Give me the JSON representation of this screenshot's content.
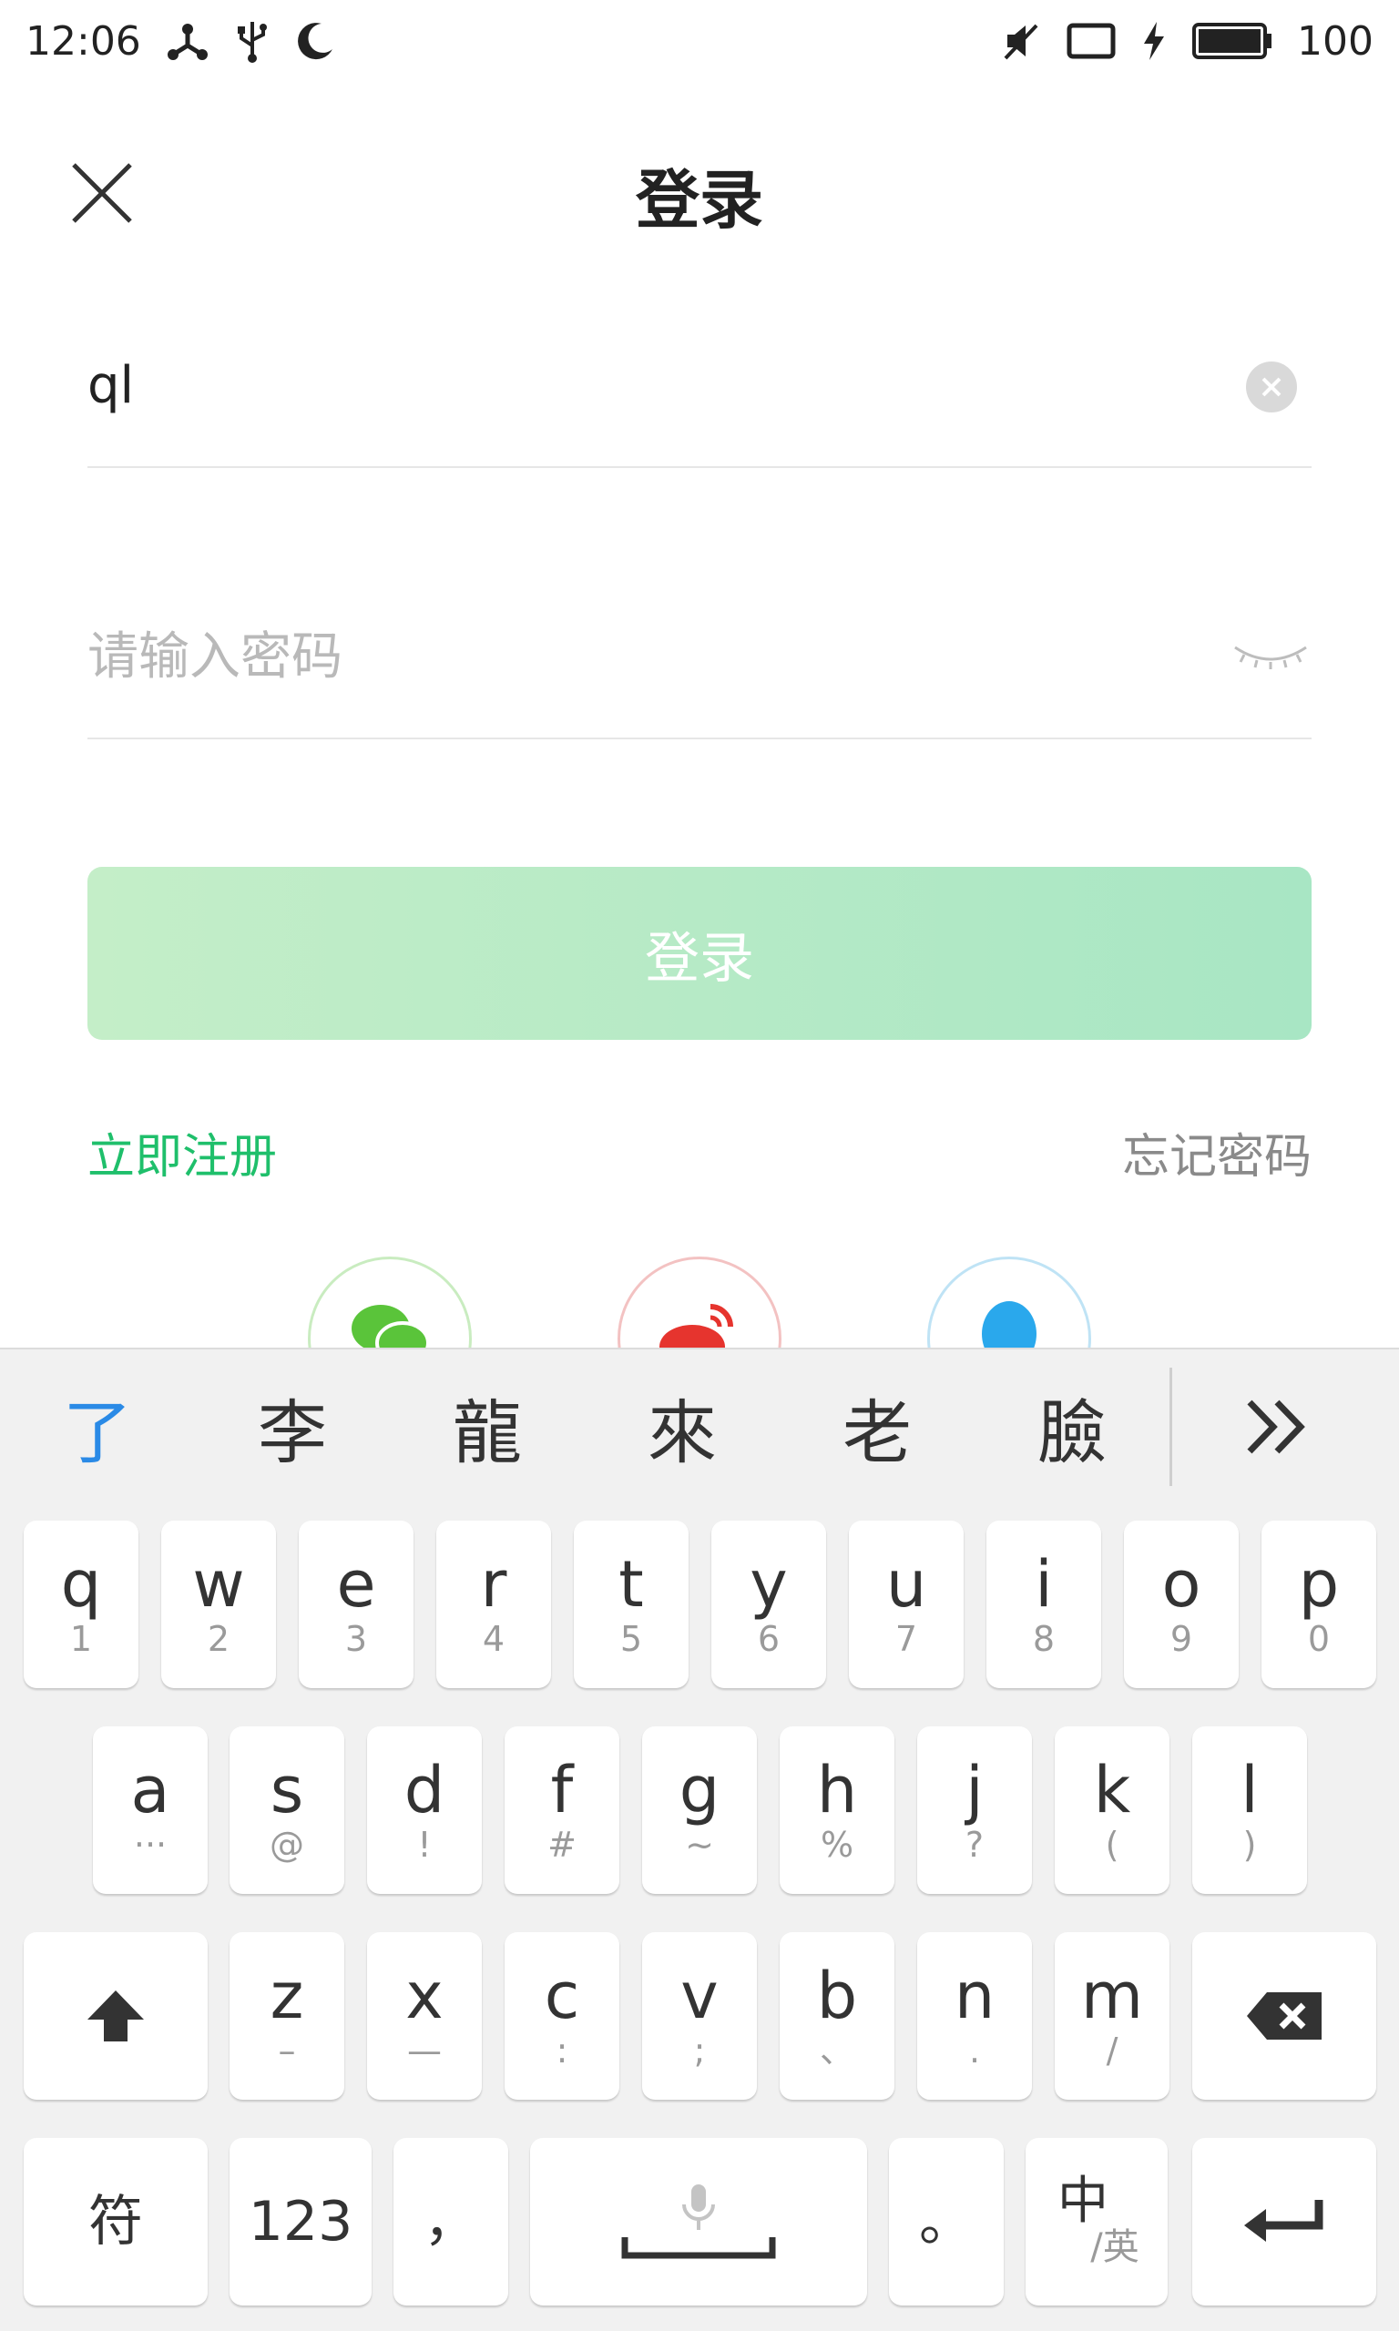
{
  "status_bar": {
    "time": "12:06",
    "battery_level": "100"
  },
  "header": {
    "title": "登录"
  },
  "form": {
    "account_value": "ql",
    "password_placeholder": "请输入密码",
    "login_label": "登录",
    "register_label": "立即注册",
    "forgot_label": "忘记密码"
  },
  "social": [
    {
      "name": "wechat",
      "color": "#5ac43a",
      "ring": "#c9ecc0"
    },
    {
      "name": "weibo",
      "color": "#e6342e",
      "ring": "#f3c2c2"
    },
    {
      "name": "qq",
      "color": "#2aa8ec",
      "ring": "#bfe3f5"
    }
  ],
  "keyboard": {
    "candidates": [
      "了",
      "李",
      "龍",
      "來",
      "老",
      "臉"
    ],
    "row1": [
      {
        "main": "q",
        "sub": "1"
      },
      {
        "main": "w",
        "sub": "2"
      },
      {
        "main": "e",
        "sub": "3"
      },
      {
        "main": "r",
        "sub": "4"
      },
      {
        "main": "t",
        "sub": "5"
      },
      {
        "main": "y",
        "sub": "6"
      },
      {
        "main": "u",
        "sub": "7"
      },
      {
        "main": "i",
        "sub": "8"
      },
      {
        "main": "o",
        "sub": "9"
      },
      {
        "main": "p",
        "sub": "0"
      }
    ],
    "row2": [
      {
        "main": "a",
        "sub": "···"
      },
      {
        "main": "s",
        "sub": "@"
      },
      {
        "main": "d",
        "sub": "!"
      },
      {
        "main": "f",
        "sub": "#"
      },
      {
        "main": "g",
        "sub": "~"
      },
      {
        "main": "h",
        "sub": "%"
      },
      {
        "main": "j",
        "sub": "?"
      },
      {
        "main": "k",
        "sub": "("
      },
      {
        "main": "l",
        "sub": ")"
      }
    ],
    "row3": [
      {
        "main": "z",
        "sub": "–"
      },
      {
        "main": "x",
        "sub": "—"
      },
      {
        "main": "c",
        "sub": ":"
      },
      {
        "main": "v",
        "sub": ";"
      },
      {
        "main": "b",
        "sub": "、"
      },
      {
        "main": "n",
        "sub": "."
      },
      {
        "main": "m",
        "sub": "/"
      }
    ],
    "symbols_label": "符",
    "numbers_label": "123",
    "comma_label": "，",
    "period_label": "。",
    "lang_main": "中",
    "lang_sub": "/英"
  }
}
